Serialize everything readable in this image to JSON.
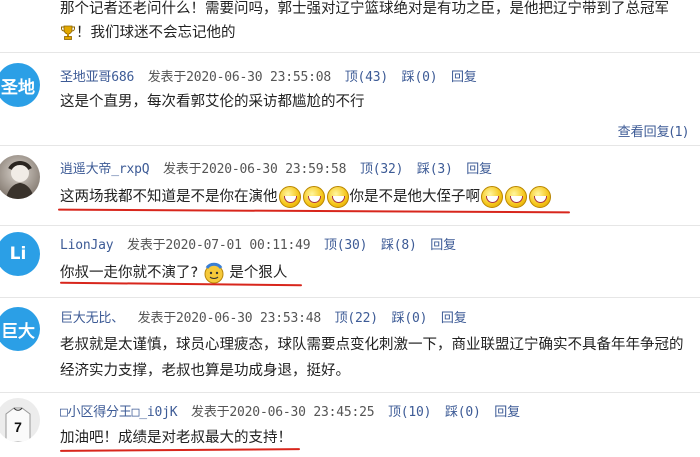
{
  "comments": [
    {
      "text1": "那个记者还老问什么！需要问吗，郭士强对辽宁篮球绝对是有功之臣，是他把辽宁带到了总冠军",
      "text2": "！我们球迷不会忘记他的"
    },
    {
      "avatar": "圣地",
      "avatar_color": "#2b9fe6",
      "user": "圣地亚哥686",
      "posted": "发表于2020-06-30 23:55:08",
      "up": "顶(43)",
      "down": "踩(0)",
      "reply": "回复",
      "text": "这是个直男，每次看郭艾伦的采访都尴尬的不行",
      "view_replies": "查看回复(1)"
    },
    {
      "avatar": "",
      "avatar_color": "#8a7a6a",
      "user": "逍遥大帝_rxpQ",
      "posted": "发表于2020-06-30 23:59:58",
      "up": "顶(32)",
      "down": "踩(3)",
      "reply": "回复",
      "text1": "这两场我都不知道是不是你在演他",
      "text2": "你是不是他大侄子啊"
    },
    {
      "avatar": "Li",
      "avatar_color": "#2b9fe6",
      "user": "LionJay",
      "posted": "发表于2020-07-01 00:11:49",
      "up": "顶(30)",
      "down": "踩(8)",
      "reply": "回复",
      "text1": "你叔一走你就不演了?",
      "text2": "是个狠人"
    },
    {
      "avatar": "巨大",
      "avatar_color": "#2b9fe6",
      "user": "巨大无比、",
      "posted": "发表于2020-06-30 23:53:48",
      "up": "顶(22)",
      "down": "踩(0)",
      "reply": "回复",
      "text": "老叔就是太谨慎，球员心理疲态，球队需要点变化刺激一下，商业联盟辽宁确实不具备年年争冠的经济实力支撑，老叔也算是功成身退，挺好。"
    },
    {
      "avatar": "7",
      "avatar_color": "#eaeaea",
      "user": "□小区得分王□_i0jK",
      "posted": "发表于2020-06-30 23:45:25",
      "up": "顶(10)",
      "down": "踩(0)",
      "reply": "回复",
      "text": "加油吧！成绩是对老叔最大的支持！"
    }
  ]
}
